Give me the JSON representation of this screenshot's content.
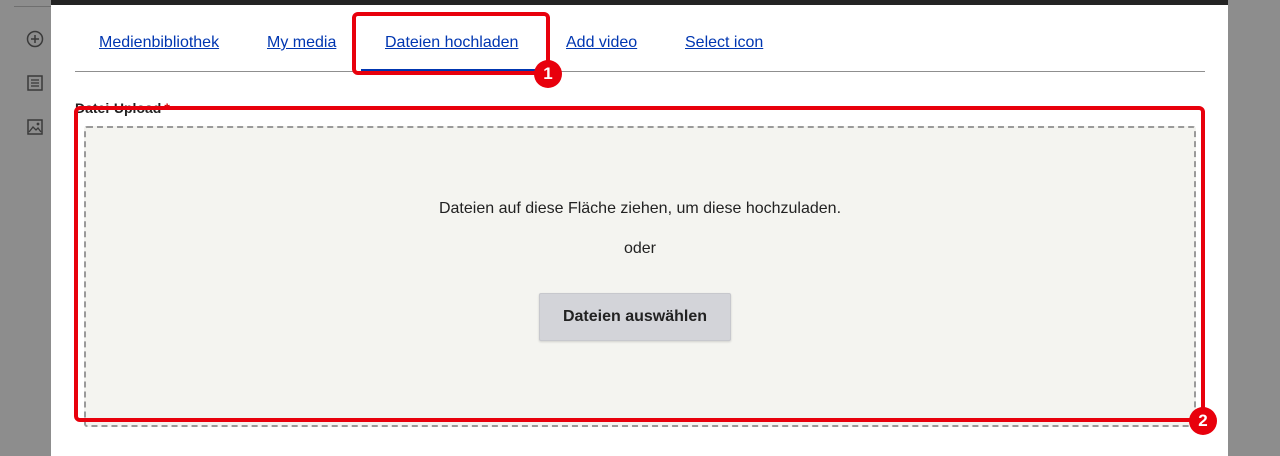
{
  "tabs": [
    {
      "label": "Medienbibliothek",
      "active": false
    },
    {
      "label": "My media",
      "active": false
    },
    {
      "label": "Dateien hochladen",
      "active": true
    },
    {
      "label": "Add video",
      "active": false
    },
    {
      "label": "Select icon",
      "active": false
    }
  ],
  "upload": {
    "label": "Datei-Upload",
    "required_marker": "*",
    "drop_text": "Dateien auf diese Fläche ziehen, um diese hochzuladen.",
    "or_text": "oder",
    "button_label": "Dateien auswählen"
  },
  "annotations": [
    {
      "label": "1"
    },
    {
      "label": "2"
    }
  ],
  "colors": {
    "link": "#0036b1",
    "annotation": "#e8000c",
    "dropzone_bg": "#f4f4f0",
    "button_bg": "#d3d4d9"
  },
  "background_icons": [
    "plus-circle-icon",
    "text-document-icon",
    "image-icon"
  ]
}
